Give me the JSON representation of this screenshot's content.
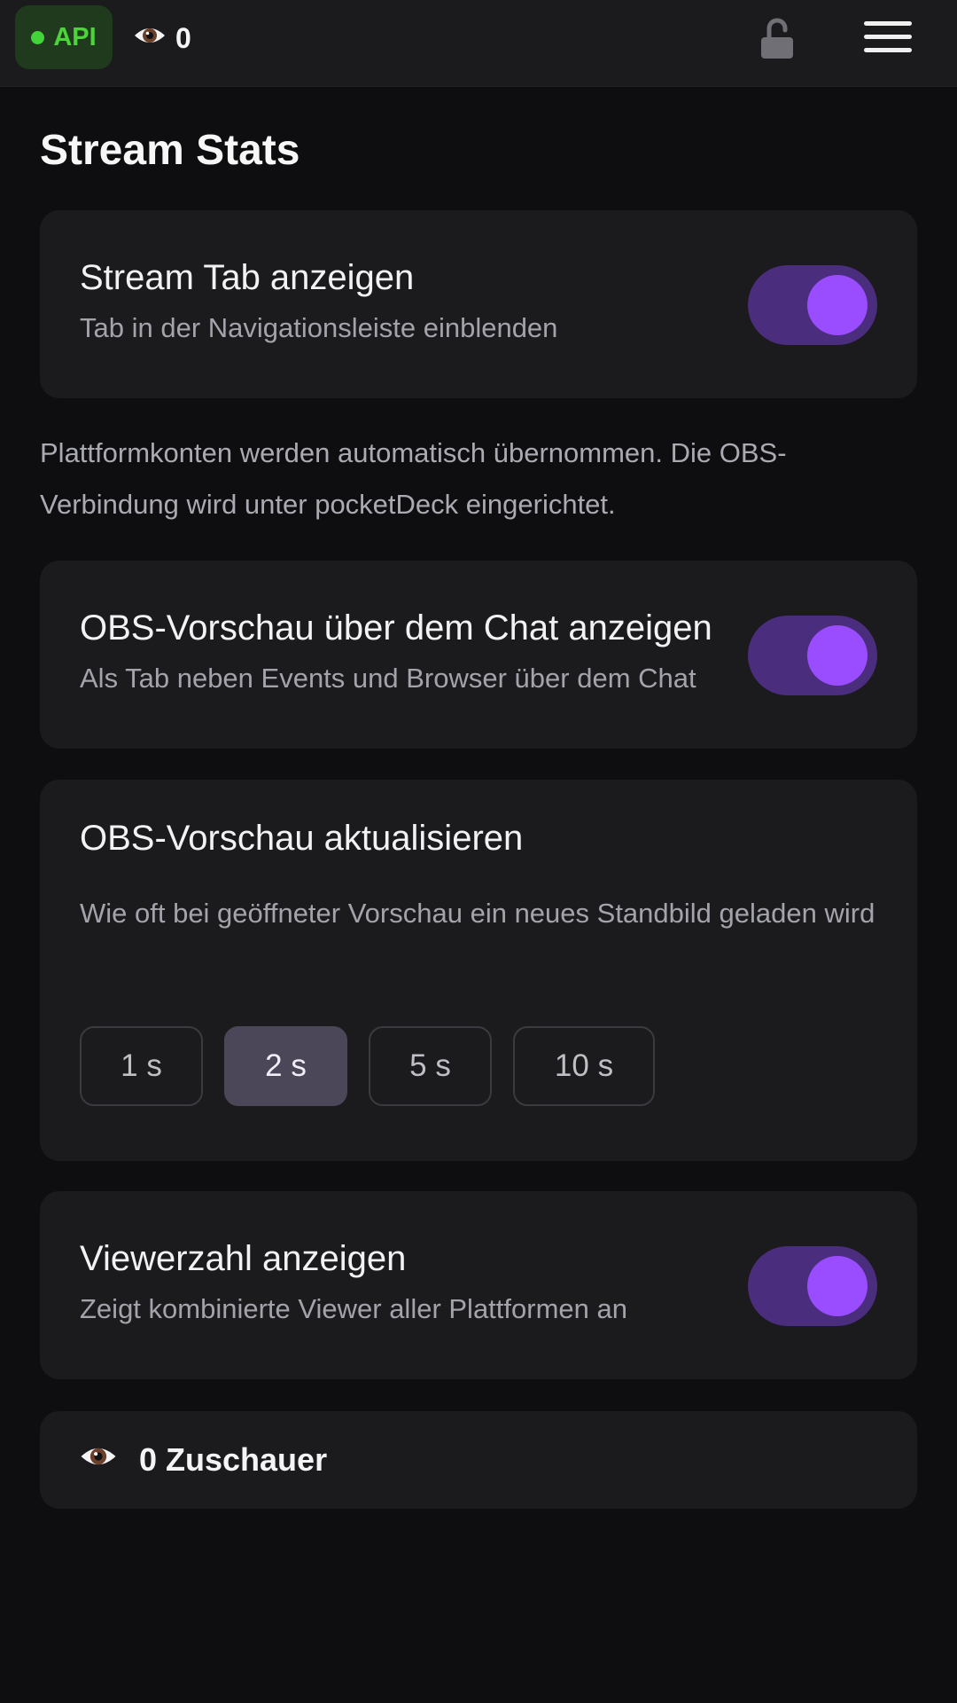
{
  "topbar": {
    "api_label": "API",
    "viewer_count": "0",
    "icons": {
      "eye": "eye-icon",
      "lock": "unlocked-lock-icon",
      "menu": "hamburger-menu-icon"
    },
    "colors": {
      "api_accent": "#4cd43a",
      "api_bg": "#1f3a1c"
    }
  },
  "page": {
    "title": "Stream Stats"
  },
  "stream_tab": {
    "title": "Stream Tab anzeigen",
    "subtitle": "Tab in der Navigationsleiste einblenden",
    "enabled": true
  },
  "info": {
    "text": "Plattformkonten werden automatisch übernommen. Die OBS-Verbindung wird unter pocketDeck eingerichtet."
  },
  "obs_preview": {
    "title": "OBS-Vorschau über dem Chat anzeigen",
    "subtitle": "Als Tab neben Events und Browser über dem Chat",
    "enabled": true
  },
  "obs_refresh": {
    "title": "OBS-Vorschau aktualisieren",
    "description": "Wie oft bei geöffneter Vorschau ein neues Standbild geladen wird",
    "options": [
      "1 s",
      "2 s",
      "5 s",
      "10 s"
    ],
    "selected": "2 s"
  },
  "viewer_toggle": {
    "title": "Viewerzahl anzeigen",
    "subtitle": "Zeigt kombinierte Viewer aller Plattformen an",
    "enabled": true
  },
  "viewer_summary": {
    "label": "0 Zuschauer"
  },
  "colors": {
    "toggle_track": "#4a2d7c",
    "toggle_knob": "#9a4dff",
    "card_bg": "#1b1b1e",
    "page_bg": "#0e0e10"
  }
}
